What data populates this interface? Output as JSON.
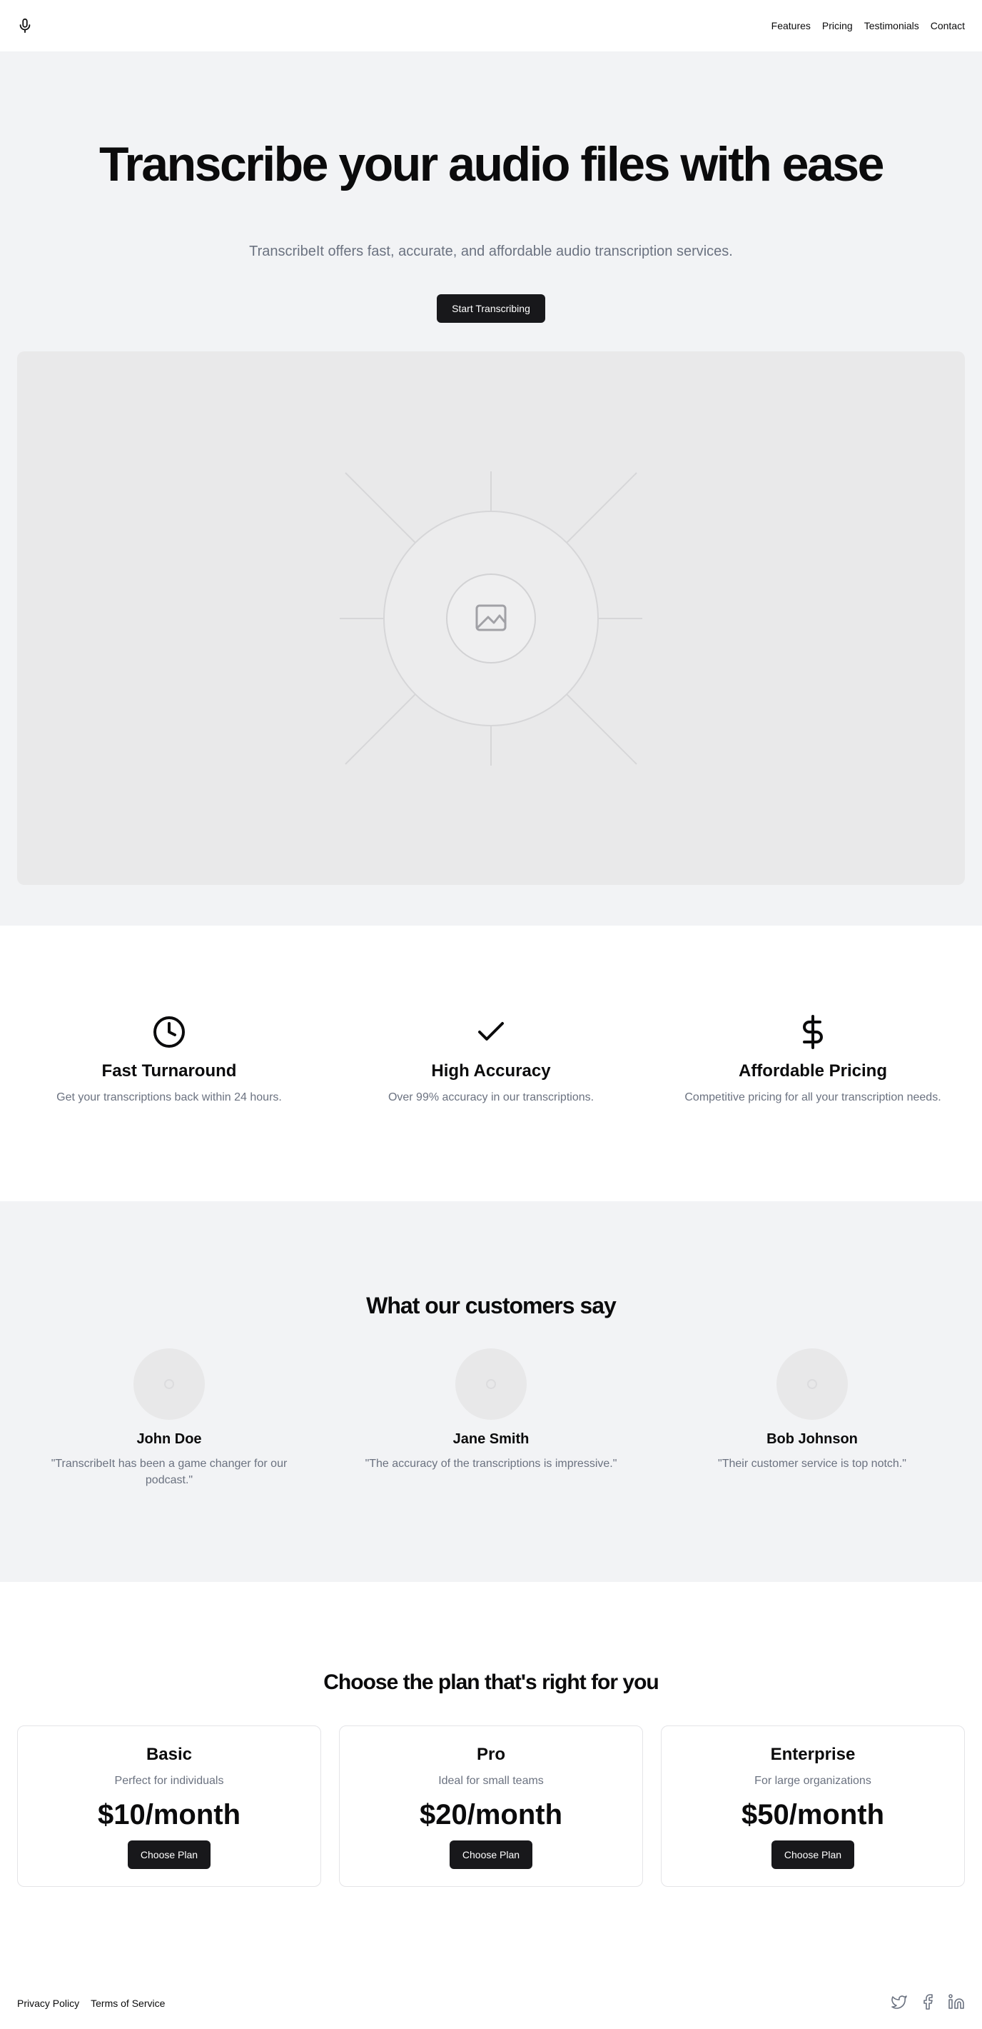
{
  "header": {
    "logo_icon": "microphone-icon",
    "nav": [
      {
        "label": "Features"
      },
      {
        "label": "Pricing"
      },
      {
        "label": "Testimonials"
      },
      {
        "label": "Contact"
      }
    ]
  },
  "hero": {
    "title": "Transcribe your audio files with ease",
    "subtitle": "TranscribeIt offers fast, accurate, and affordable audio transcription services.",
    "cta_label": "Start Transcribing",
    "image_icon": "image-placeholder-icon"
  },
  "features": [
    {
      "icon": "clock-icon",
      "title": "Fast Turnaround",
      "text": "Get your transcriptions back within 24 hours."
    },
    {
      "icon": "checkmark-icon",
      "title": "High Accuracy",
      "text": "Over 99% accuracy in our transcriptions."
    },
    {
      "icon": "dollar-icon",
      "title": "Affordable Pricing",
      "text": "Competitive pricing for all your transcription needs."
    }
  ],
  "testimonials": {
    "heading": "What our customers say",
    "items": [
      {
        "name": "John Doe",
        "quote": "\"TranscribeIt has been a game changer for our podcast.\""
      },
      {
        "name": "Jane Smith",
        "quote": "\"The accuracy of the transcriptions is impressive.\""
      },
      {
        "name": "Bob Johnson",
        "quote": "\"Their customer service is top notch.\""
      }
    ]
  },
  "pricing": {
    "heading": "Choose the plan that's right for you",
    "plans": [
      {
        "name": "Basic",
        "desc": "Perfect for individuals",
        "price": "$10/month",
        "cta": "Choose Plan"
      },
      {
        "name": "Pro",
        "desc": "Ideal for small teams",
        "price": "$20/month",
        "cta": "Choose Plan"
      },
      {
        "name": "Enterprise",
        "desc": "For large organizations",
        "price": "$50/month",
        "cta": "Choose Plan"
      }
    ]
  },
  "footer": {
    "links": [
      {
        "label": "Privacy Policy"
      },
      {
        "label": "Terms of Service"
      }
    ],
    "social_icons": [
      "twitter-icon",
      "facebook-icon",
      "linkedin-icon"
    ]
  },
  "colors": {
    "primary_button": "#18181b",
    "muted_text": "#6b7280",
    "section_bg": "#f2f3f5"
  }
}
